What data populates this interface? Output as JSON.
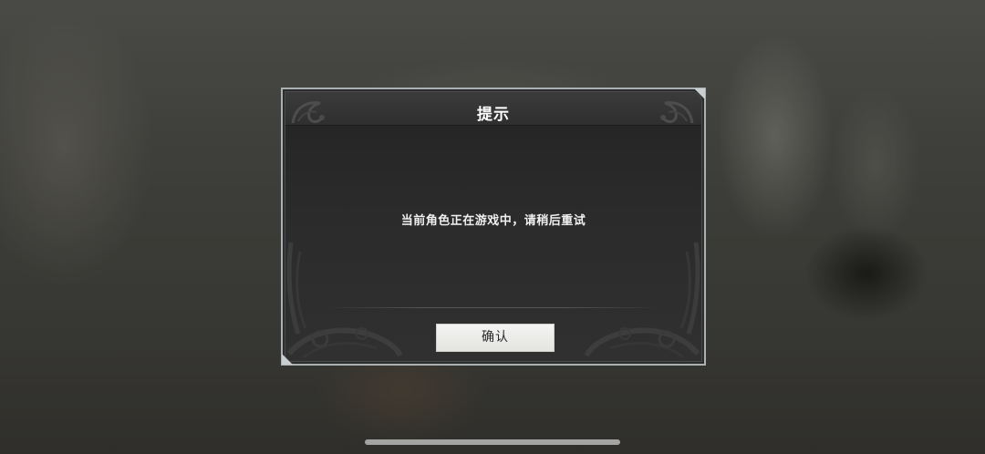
{
  "dialog": {
    "title": "提示",
    "message": "当前角色正在游戏中，请稍后重试",
    "confirm_label": "确认"
  },
  "colors": {
    "dialog_border": "#aab1b3",
    "dialog_background": "#2d2d2d",
    "button_background": "#f0f0ee",
    "text_light": "#ffffff"
  }
}
